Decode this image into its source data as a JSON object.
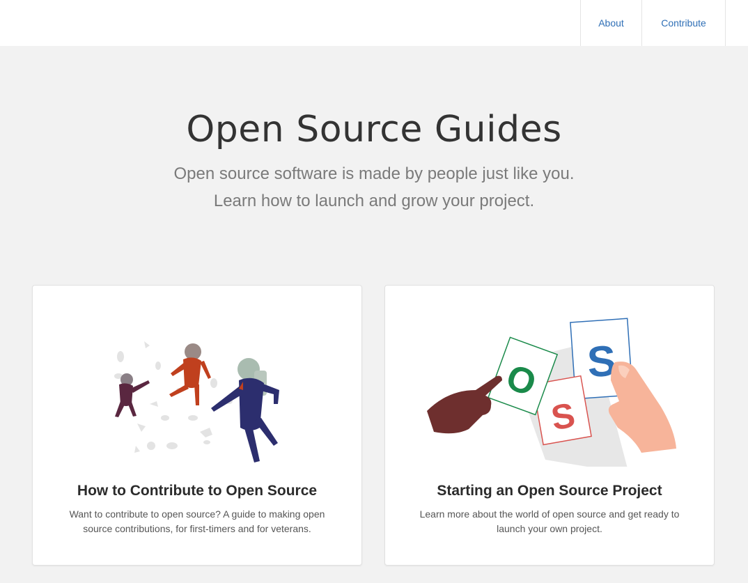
{
  "nav": {
    "about": "About",
    "contribute": "Contribute"
  },
  "hero": {
    "title": "Open Source Guides",
    "subtitle_line1": "Open source software is made by people just like you.",
    "subtitle_line2": "Learn how to launch and grow your project."
  },
  "cards": [
    {
      "title": "How to Contribute to Open Source",
      "description": "Want to contribute to open source? A guide to making open source contributions, for first-timers and for veterans.",
      "illustration": "astronauts-illustration"
    },
    {
      "title": "Starting an Open Source Project",
      "description": "Learn more about the world of open source and get ready to launch your own project.",
      "illustration": "oss-cards-illustration",
      "card_letters": [
        "O",
        "S",
        "S"
      ]
    }
  ],
  "colors": {
    "link": "#2f6fb6",
    "background": "#f2f2f2"
  }
}
